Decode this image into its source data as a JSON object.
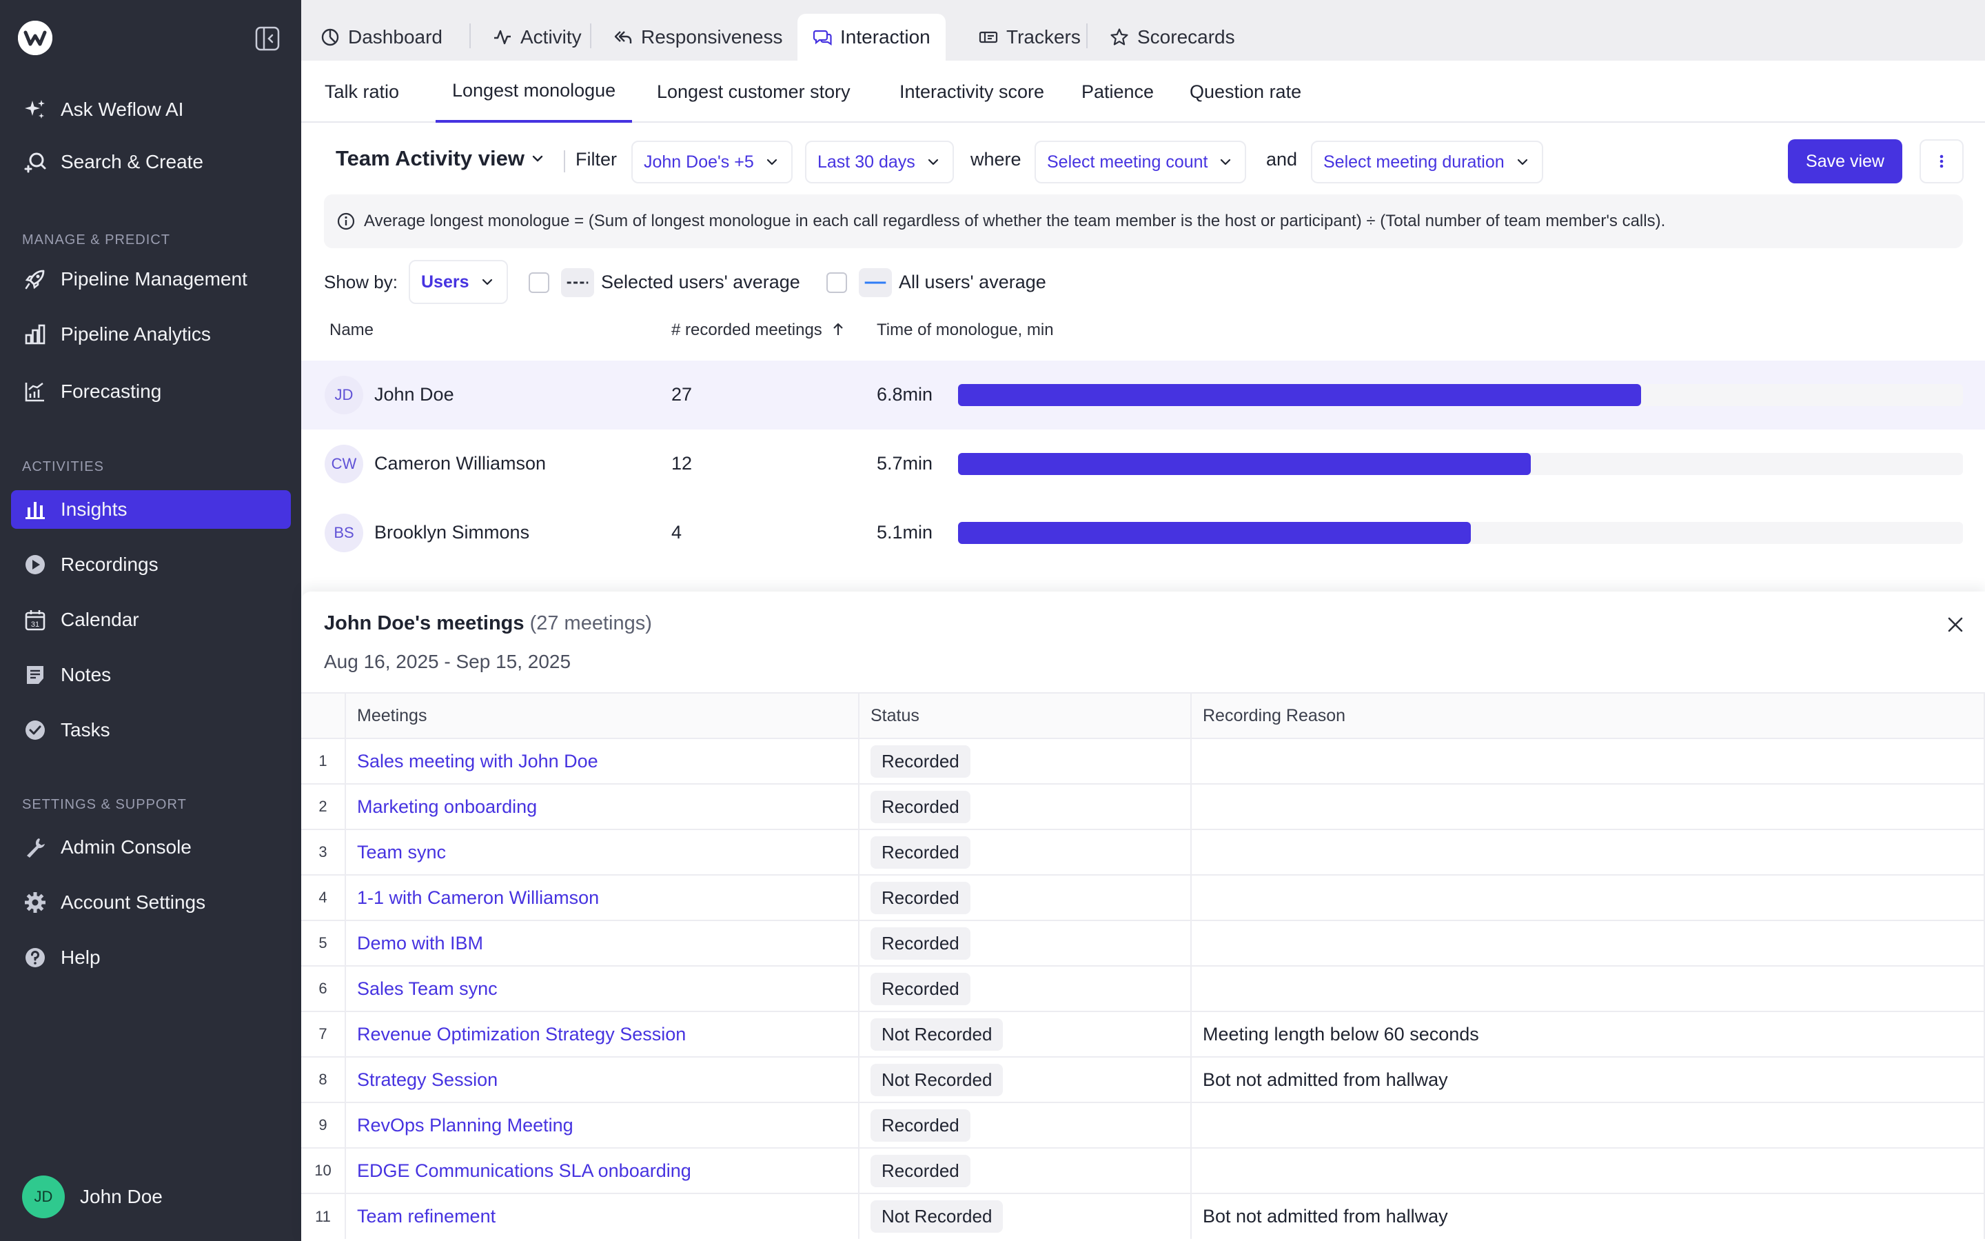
{
  "sidebar": {
    "items": [
      {
        "label": "Ask Weflow AI",
        "icon": "sparkle-icon"
      },
      {
        "label": "Search & Create",
        "icon": "search-plus-icon"
      }
    ],
    "manage_heading": "MANAGE & PREDICT",
    "manage_items": [
      {
        "label": "Pipeline Management",
        "icon": "rocket-icon"
      },
      {
        "label": "Pipeline Analytics",
        "icon": "bar-analytics-icon"
      },
      {
        "label": "Forecasting",
        "icon": "forecast-chart-icon"
      }
    ],
    "activities_heading": "ACTIVITIES",
    "activities_items": [
      {
        "label": "Insights",
        "icon": "insights-bars-icon",
        "active": true
      },
      {
        "label": "Recordings",
        "icon": "play-circle-icon"
      },
      {
        "label": "Calendar",
        "icon": "calendar-icon",
        "day": "31"
      },
      {
        "label": "Notes",
        "icon": "note-icon"
      },
      {
        "label": "Tasks",
        "icon": "check-circle-icon"
      }
    ],
    "settings_heading": "SETTINGS & SUPPORT",
    "settings_items": [
      {
        "label": "Admin Console",
        "icon": "wrench-icon"
      },
      {
        "label": "Account Settings",
        "icon": "gear-icon"
      },
      {
        "label": "Help",
        "icon": "help-circle-icon"
      }
    ],
    "user": {
      "initials": "JD",
      "name": "John Doe"
    }
  },
  "top_tabs": [
    {
      "label": "Dashboard",
      "icon": "dashboard-gauge-icon"
    },
    {
      "label": "Activity",
      "icon": "activity-pulse-icon"
    },
    {
      "label": "Responsiveness",
      "icon": "reply-arrow-icon"
    },
    {
      "label": "Interaction",
      "icon": "chat-bubbles-icon",
      "active": true
    },
    {
      "label": "Trackers",
      "icon": "tracker-tag-icon"
    },
    {
      "label": "Scorecards",
      "icon": "star-icon"
    }
  ],
  "sub_tabs": [
    {
      "label": "Talk ratio"
    },
    {
      "label": "Longest monologue",
      "active": true
    },
    {
      "label": "Longest customer story"
    },
    {
      "label": "Interactivity score"
    },
    {
      "label": "Patience"
    },
    {
      "label": "Question rate"
    }
  ],
  "filters": {
    "view_title": "Team Activity view",
    "filter_label": "Filter",
    "users": "John Doe's +5",
    "range": "Last 30 days",
    "where": "where",
    "meeting_count": "Select meeting count",
    "and": "and",
    "meeting_duration": "Select meeting duration",
    "save_label": "Save view"
  },
  "info_text": "Average longest monologue = (Sum of longest monologue in each call regardless of whether the team member is the host or participant) ÷ (Total number of team member's calls).",
  "show_by": {
    "label": "Show by:",
    "value": "Users",
    "selected_avg_label": "Selected users' average",
    "all_avg_label": "All users' average",
    "accent": "#4633e0",
    "all_avg_color": "#2f7df6"
  },
  "team_table": {
    "headers": {
      "name": "Name",
      "count": "# recorded meetings",
      "time": "Time of monologue, min"
    },
    "rows": [
      {
        "initials": "JD",
        "name": "John Doe",
        "count": "27",
        "time": "6.8min",
        "value": 6.8
      },
      {
        "initials": "CW",
        "name": "Cameron Williamson",
        "count": "12",
        "time": "5.7min",
        "value": 5.7
      },
      {
        "initials": "BS",
        "name": "Brooklyn Simmons",
        "count": "4",
        "time": "5.1min",
        "value": 5.1
      }
    ],
    "scale_max": 10
  },
  "panel": {
    "title": "John Doe's meetings",
    "count": "(27 meetings)",
    "range": "Aug 16, 2025 - Sep 15, 2025",
    "headers": {
      "meetings": "Meetings",
      "status": "Status",
      "reason": "Recording Reason"
    },
    "rows": [
      {
        "n": "1",
        "meeting": "Sales meeting with John Doe",
        "status": "Recorded",
        "reason": ""
      },
      {
        "n": "2",
        "meeting": "Marketing onboarding",
        "status": "Recorded",
        "reason": ""
      },
      {
        "n": "3",
        "meeting": "Team sync",
        "status": "Recorded",
        "reason": ""
      },
      {
        "n": "4",
        "meeting": "1-1 with Cameron Williamson",
        "status": "Recorded",
        "reason": ""
      },
      {
        "n": "5",
        "meeting": "Demo with IBM",
        "status": "Recorded",
        "reason": ""
      },
      {
        "n": "6",
        "meeting": "Sales Team sync",
        "status": "Recorded",
        "reason": ""
      },
      {
        "n": "7",
        "meeting": "Revenue Optimization Strategy Session",
        "status": "Not Recorded",
        "reason": "Meeting length below 60 seconds"
      },
      {
        "n": "8",
        "meeting": "Strategy Session",
        "status": "Not Recorded",
        "reason": "Bot not admitted from hallway"
      },
      {
        "n": "9",
        "meeting": "RevOps Planning Meeting",
        "status": "Recorded",
        "reason": ""
      },
      {
        "n": "10",
        "meeting": "EDGE Communications SLA onboarding",
        "status": "Recorded",
        "reason": ""
      },
      {
        "n": "11",
        "meeting": "Team refinement",
        "status": "Not Recorded",
        "reason": "Bot not admitted from hallway"
      }
    ]
  }
}
